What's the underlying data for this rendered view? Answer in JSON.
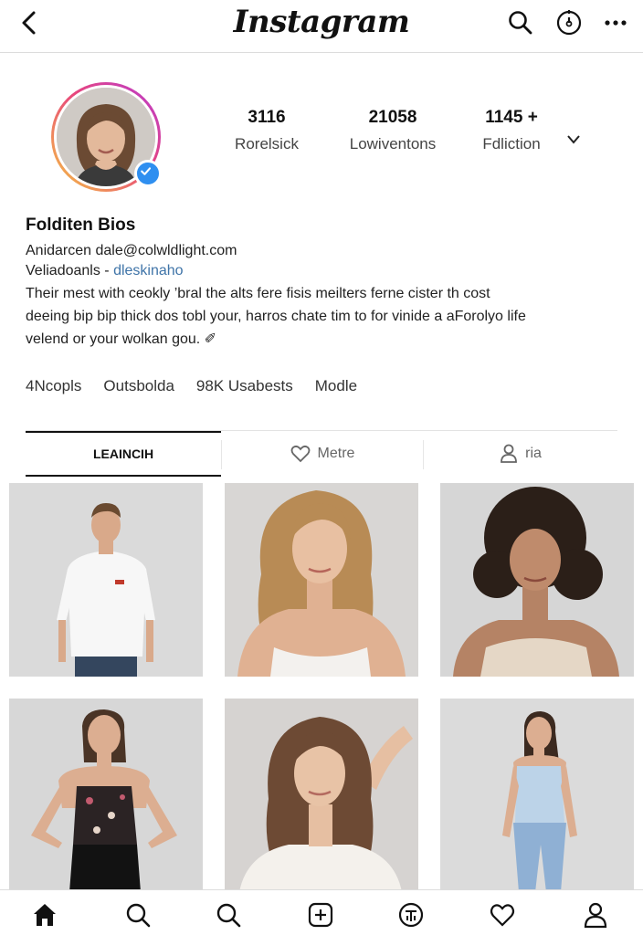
{
  "app": {
    "logo": "Instagram"
  },
  "profile": {
    "display_name": "Folditen Bios",
    "stats": [
      {
        "value": "3116",
        "label": "Rorelsick"
      },
      {
        "value": "21058",
        "label": "Lowiventons"
      },
      {
        "value": "1145 +",
        "label": "Fdliction"
      }
    ],
    "bio_line1": "Anidarcen dale@colwldlight.com",
    "bio_line2_prefix": "Veliadoanls - ",
    "bio_line2_link": "dleskinaho",
    "bio_text_1": "Their mest with ceokly ’bral the alts fere fisis meilters ferne cister th cost",
    "bio_text_2": "deeing bip bip thick dos tobl your, harros chate tim to for vinide a aForolyo life",
    "bio_text_3": "velend or your wolkan gou. ✐"
  },
  "highlights": [
    "4Ncopls",
    "Outsbolda",
    "98K Usabests",
    "Modle"
  ],
  "tabs": [
    {
      "label": "LEAINCIH",
      "icon": "none",
      "active": true
    },
    {
      "label": "Metre",
      "icon": "heart-icon",
      "active": false
    },
    {
      "label": "ria",
      "icon": "person-icon",
      "active": false
    }
  ],
  "grid": [
    {
      "subject": "man-white-tshirt"
    },
    {
      "subject": "woman-blonde-camisole"
    },
    {
      "subject": "woman-curly-hair-lace-top"
    },
    {
      "subject": "woman-floral-top"
    },
    {
      "subject": "woman-brunette-white-shirt"
    },
    {
      "subject": "woman-blue-top-jeans"
    }
  ],
  "bottom_nav": [
    "home-icon",
    "search-icon",
    "explore-icon",
    "add-post-icon",
    "reels-icon",
    "activity-heart-icon",
    "profile-icon"
  ],
  "colors": {
    "accent_blue": "#2f8ff0",
    "link": "#3f74a8",
    "border": "#dcdcdc"
  }
}
